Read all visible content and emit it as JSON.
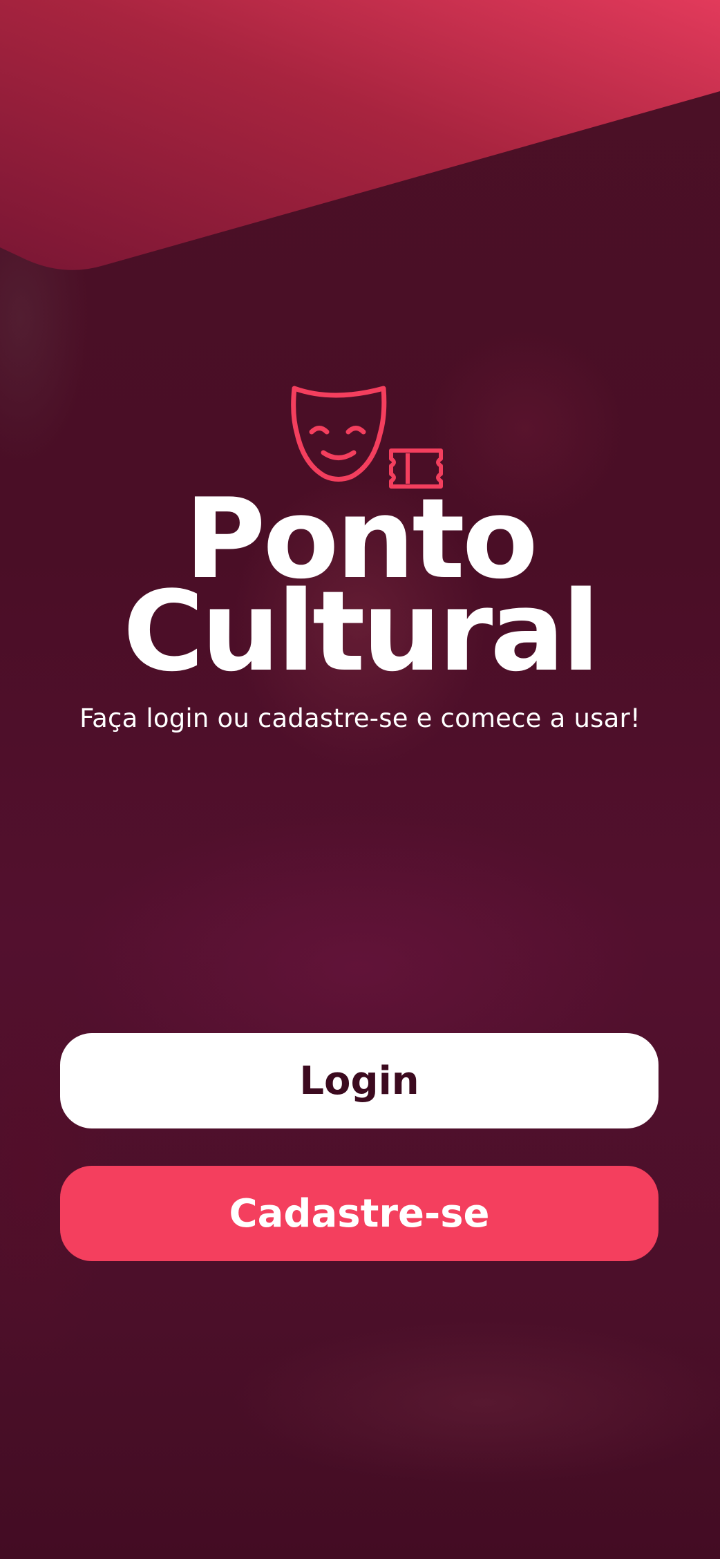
{
  "app": {
    "title_line1": "Ponto",
    "title_line2": "Cultural",
    "subtitle": "Faça login ou cadastre-se e comece a usar!"
  },
  "actions": {
    "login_label": "Login",
    "signup_label": "Cadastre-se"
  },
  "icons": {
    "logo_mask": "theater-mask-icon",
    "logo_ticket": "ticket-icon"
  },
  "colors": {
    "background": "#4a0f28",
    "accent": "#f43f5e",
    "banner_light": "#e03a5a",
    "banner_dark": "#8c1a3b",
    "login_text": "#3c0a1f",
    "white": "#ffffff"
  }
}
